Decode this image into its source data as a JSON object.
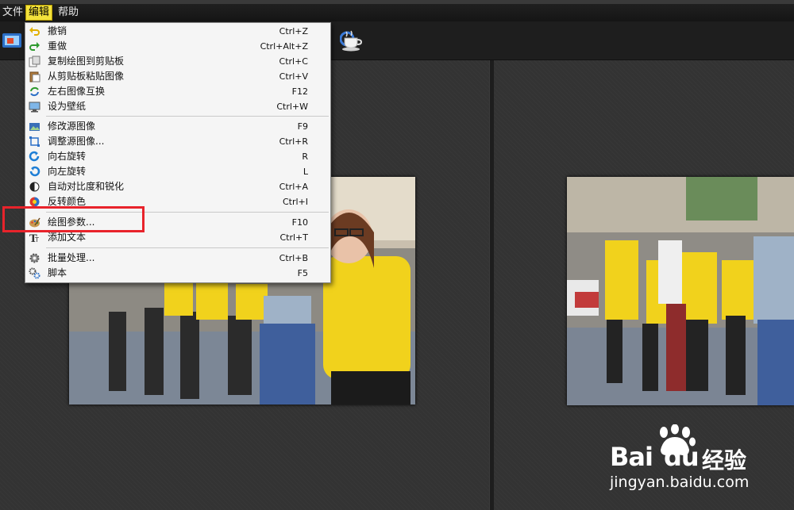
{
  "menubar": {
    "file": "文件",
    "edit": "编辑",
    "help": "帮助"
  },
  "edit_menu": {
    "group1": [
      {
        "label": "撤销",
        "shortcut": "Ctrl+Z",
        "icon": "undo-icon"
      },
      {
        "label": "重做",
        "shortcut": "Ctrl+Alt+Z",
        "icon": "redo-icon"
      },
      {
        "label": "复制绘图到剪贴板",
        "shortcut": "Ctrl+C",
        "icon": "copy-icon"
      },
      {
        "label": "从剪贴板粘贴图像",
        "shortcut": "Ctrl+V",
        "icon": "paste-icon"
      },
      {
        "label": "左右图像互换",
        "shortcut": "F12",
        "icon": "swap-icon"
      },
      {
        "label": "设为壁纸",
        "shortcut": "Ctrl+W",
        "icon": "wallpaper-icon"
      }
    ],
    "group2": [
      {
        "label": "修改源图像",
        "shortcut": "F9",
        "icon": "edit-image-icon"
      },
      {
        "label": "调整源图像...",
        "shortcut": "Ctrl+R",
        "icon": "crop-icon"
      },
      {
        "label": "向右旋转",
        "shortcut": "R",
        "icon": "rotate-right-icon"
      },
      {
        "label": "向左旋转",
        "shortcut": "L",
        "icon": "rotate-left-icon"
      },
      {
        "label": "自动对比度和锐化",
        "shortcut": "Ctrl+A",
        "icon": "contrast-icon"
      },
      {
        "label": "反转颜色",
        "shortcut": "Ctrl+I",
        "icon": "invert-colors-icon"
      }
    ],
    "group3": [
      {
        "label": "绘图参数...",
        "shortcut": "F10",
        "icon": "palette-icon"
      },
      {
        "label": "添加文本",
        "shortcut": "Ctrl+T",
        "icon": "text-icon"
      }
    ],
    "group4": [
      {
        "label": "批量处理...",
        "shortcut": "Ctrl+B",
        "icon": "batch-gear-icon"
      },
      {
        "label": "脚本",
        "shortcut": "F5",
        "icon": "script-gears-icon"
      }
    ]
  },
  "watermark": {
    "brand_bai": "Bai",
    "brand_du": "du",
    "brand_jy": "经验",
    "url": "jingyan.baidu.com"
  },
  "colors": {
    "menu_active": "#f3e23c",
    "highlight_box": "#e8232b",
    "shirt_yellow": "#f1d21c"
  }
}
